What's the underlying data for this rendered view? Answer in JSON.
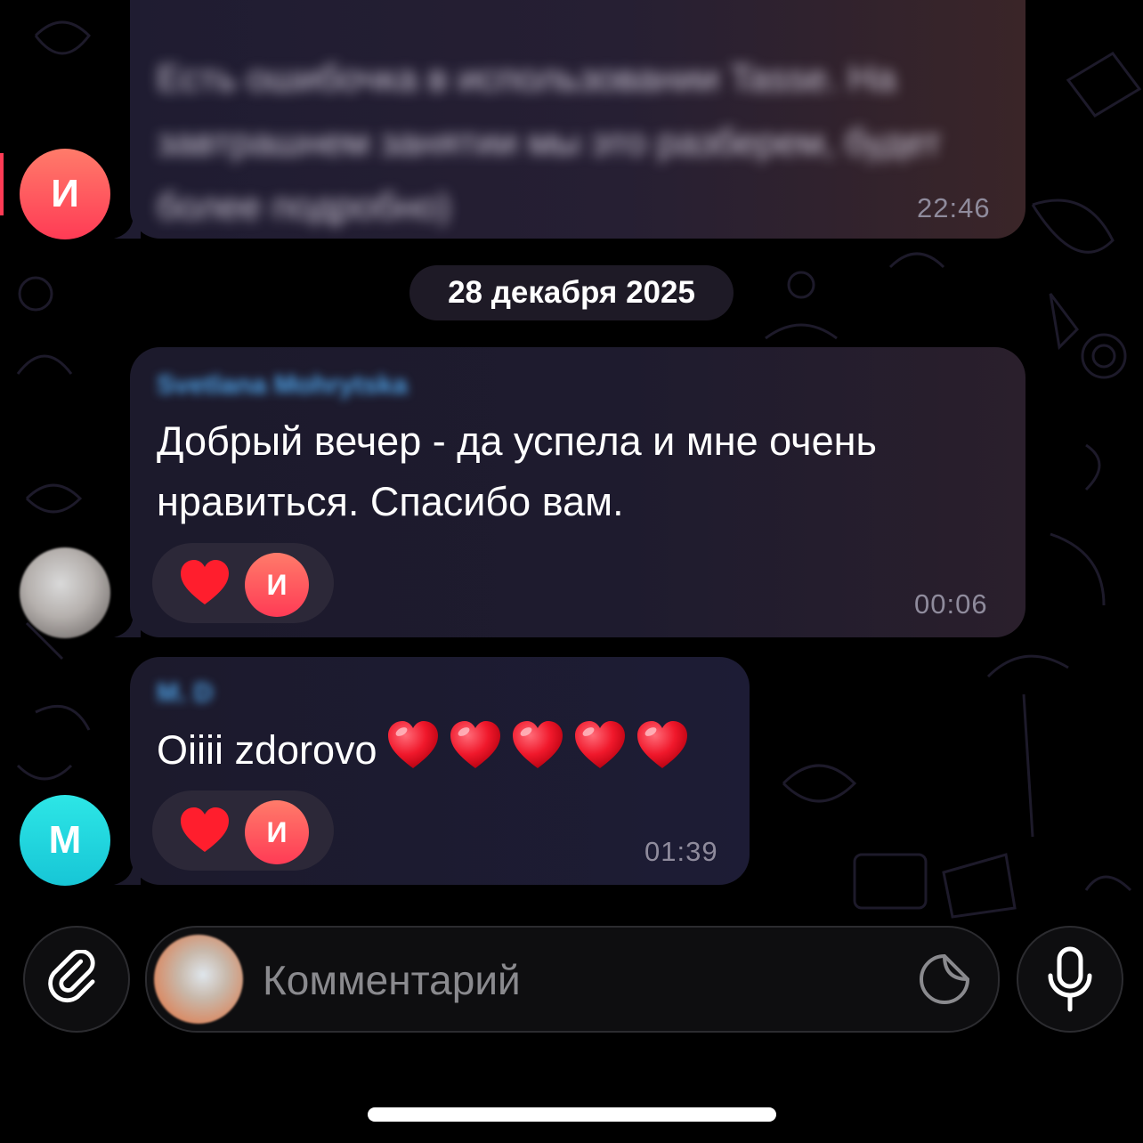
{
  "messages": [
    {
      "avatar_letter": "И",
      "text": "Есть ошибочка в использовании Tasse. На завтрашнем занятии мы это разберем, будет более подробно)",
      "time": "22:46",
      "blurred": true
    },
    {
      "sender": "Svetlana Mohrytska",
      "text": "Добрый вечер - да успела и мне очень нравиться. Спасибо вам.",
      "time": "00:06",
      "reaction": {
        "emoji": "heart-icon",
        "avatar_letter": "И"
      }
    },
    {
      "avatar_letter": "M",
      "sender": "M. D",
      "text": "Oiiii zdorovo",
      "emoji_hearts": 5,
      "time": "01:39",
      "reaction": {
        "emoji": "heart-icon",
        "avatar_letter": "И"
      }
    }
  ],
  "date_separator": "28 декабря 2025",
  "composer": {
    "placeholder": "Комментарий"
  },
  "colors": {
    "background": "#000000",
    "bubble": "#1e1b2e",
    "accent_red": "#ff3b55",
    "accent_cyan": "#17c6d6",
    "sender_blue": "#4fa3e8"
  },
  "icons": [
    "paperclip-icon",
    "sticker-icon",
    "microphone-icon",
    "heart-icon"
  ]
}
